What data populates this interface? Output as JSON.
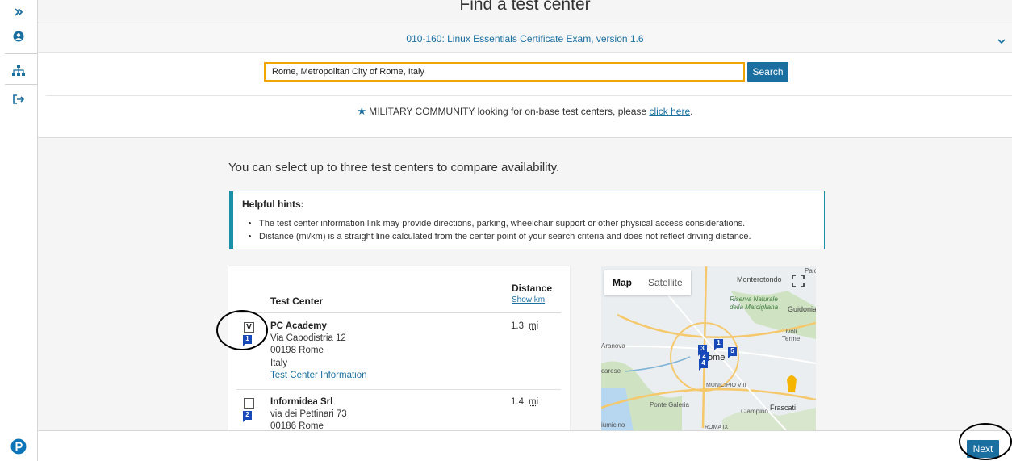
{
  "page": {
    "title": "Find a test center"
  },
  "exam": {
    "name": "010-160: Linux Essentials Certificate Exam, version 1.6"
  },
  "search": {
    "value": "Rome, Metropolitan City of Rome, Italy",
    "button_label": "Search"
  },
  "military": {
    "text": "MILITARY COMMUNITY looking for on-base test centers, please",
    "link": "click here",
    "suffix": "."
  },
  "compare_text": "You can select up to three test centers to compare availability.",
  "hints": {
    "title": "Helpful hints:",
    "items": [
      "The test center information link may provide directions, parking, wheelchair support or other physical access considerations.",
      "Distance (mi/km) is a straight line calculated from the center point of your search criteria and does not reflect driving distance."
    ]
  },
  "results": {
    "col_center": "Test Center",
    "col_distance": "Distance",
    "show_km": "Show km",
    "centers": [
      {
        "pin": "1",
        "checked_mark": "V",
        "name": "PC Academy",
        "street": "Via Capodistria 12",
        "city": "00198 Rome",
        "country": "Italy",
        "info_link": "Test Center Information",
        "distance": "1.3",
        "unit": "mi"
      },
      {
        "pin": "2",
        "checked_mark": "",
        "name": "Informidea Srl",
        "street": "via dei Pettinari 73",
        "city": "00186 Rome",
        "distance": "1.4",
        "unit": "mi"
      }
    ]
  },
  "map": {
    "tab_map": "Map",
    "tab_satellite": "Satellite",
    "labels": [
      "Monterotondo",
      "Riserva Naturale della Marcigliana",
      "Guidonia",
      "Tivoli Terme",
      "Aranova",
      "Rome",
      "MUNICIPIO VIII",
      "Ponte Galeria",
      "Ciampino",
      "Frascati",
      "ROMA IX",
      "Palo",
      "carese",
      "iumicino"
    ],
    "pins": [
      "1",
      "2",
      "3",
      "4",
      "5"
    ]
  },
  "footer": {
    "next_label": "Next"
  },
  "colors": {
    "primary": "#1a6fa0",
    "search_border": "#f0a500",
    "hint_border": "#1a8fa8",
    "pin": "#1749b8"
  },
  "icons": {
    "rail": [
      "expand-icon",
      "user-icon",
      "sitemap-icon",
      "logout-icon",
      "pearson-logo"
    ]
  }
}
